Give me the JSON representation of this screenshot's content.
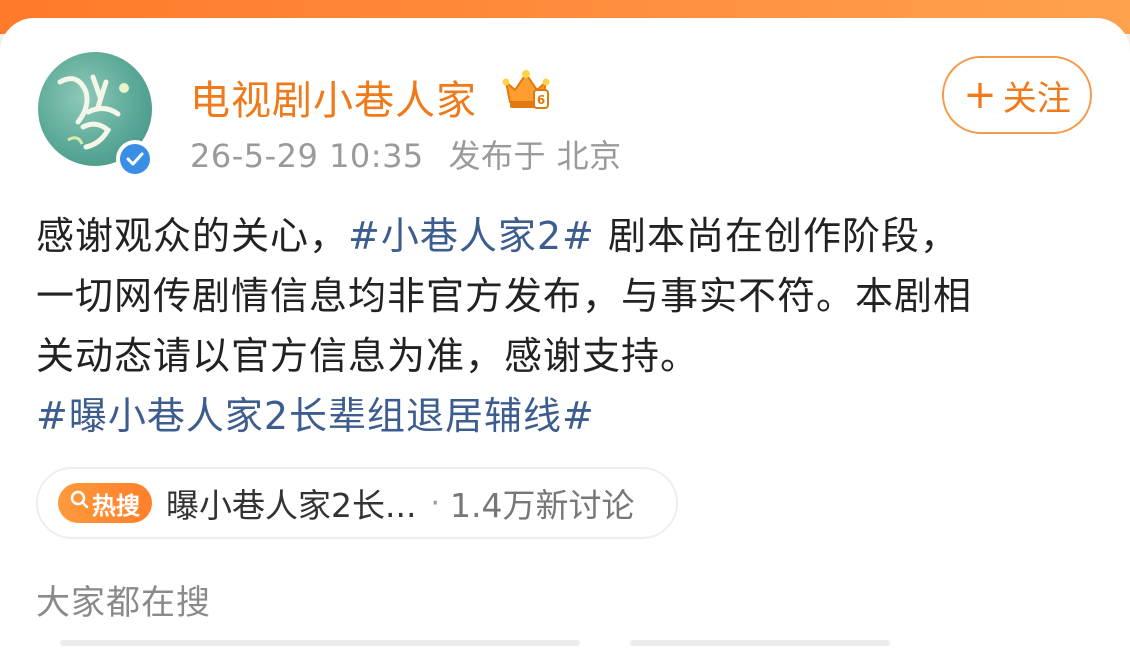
{
  "post": {
    "author_name": "电视剧小巷人家",
    "timestamp": "26-5-29 10:35",
    "location_label": "发布于 北京",
    "follow_label": "关注",
    "follow_plus": "+",
    "content": {
      "line1_prefix": "感谢观众的关心，",
      "line1_tag": "#小巷人家2#",
      "line1_suffix": " 剧本尚在创作阶段，",
      "line2": "一切网传剧情信息均非官方发布，与事实不符。本剧相",
      "line3": "关动态请以官方信息为准，感谢支持。",
      "line4_tag": "#曝小巷人家2长辈组退居辅线#"
    },
    "hot_search": {
      "badge_label": "热搜",
      "title": "曝小巷人家2长...",
      "separator": "·",
      "discussion": "1.4万新讨论"
    }
  },
  "section": {
    "everyone_searching": "大家都在搜"
  },
  "colors": {
    "brand_orange": "#f07a1a",
    "tag_blue": "#3d5d8f",
    "verified_blue": "#3a8ee6"
  },
  "icons": {
    "verified": "verified-check-icon",
    "crown": "vip-crown-icon",
    "hot_search": "hot-search-icon"
  }
}
